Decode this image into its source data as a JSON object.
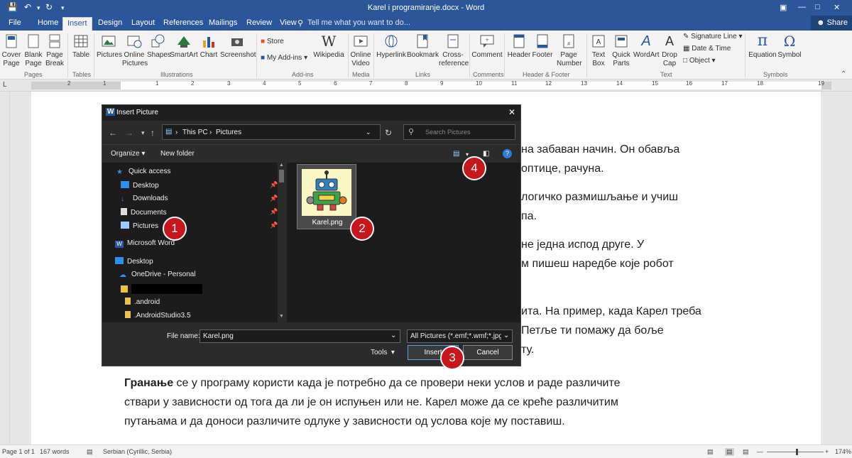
{
  "window": {
    "title": "Karel i programiranje.docx - Word"
  },
  "tabs": [
    "File",
    "Home",
    "Insert",
    "Design",
    "Layout",
    "References",
    "Mailings",
    "Review",
    "View"
  ],
  "active_tab": "Insert",
  "tell_me": "Tell me what you want to do...",
  "share": "Share",
  "ribbon": {
    "pages": {
      "group": "Pages",
      "cover": "Cover\nPage",
      "blank": "Blank\nPage",
      "break": "Page\nBreak"
    },
    "tables": {
      "group": "Tables",
      "table": "Table"
    },
    "illustrations": {
      "group": "Illustrations",
      "pictures": "Pictures",
      "online": "Online\nPictures",
      "shapes": "Shapes",
      "smartart": "SmartArt",
      "chart": "Chart",
      "screenshot": "Screenshot"
    },
    "addins": {
      "group": "Add-ins",
      "store": "Store",
      "myaddins": "My Add-ins",
      "wikipedia": "Wikipedia"
    },
    "media": {
      "group": "Media",
      "video": "Online\nVideo"
    },
    "links": {
      "group": "Links",
      "hyperlink": "Hyperlink",
      "bookmark": "Bookmark",
      "cross": "Cross-\nreference"
    },
    "comments": {
      "group": "Comments",
      "comment": "Comment"
    },
    "hf": {
      "group": "Header & Footer",
      "header": "Header",
      "footer": "Footer",
      "pagenum": "Page\nNumber"
    },
    "text": {
      "group": "Text",
      "textbox": "Text\nBox",
      "quickparts": "Quick\nParts",
      "wordart": "WordArt",
      "dropcap": "Drop\nCap",
      "sigline": "Signature Line",
      "datetime": "Date & Time",
      "object": "Object"
    },
    "symbols": {
      "group": "Symbols",
      "equation": "Equation",
      "symbol": "Symbol"
    }
  },
  "ruler_ticks": [
    "L",
    "2",
    "1",
    "1",
    "2",
    "3",
    "4",
    "5",
    "6",
    "7",
    "8",
    "9",
    "10",
    "11",
    "12",
    "13",
    "14",
    "15",
    "16",
    "17",
    "18",
    "19"
  ],
  "document": {
    "lines": [
      "на забаван начин. Он обавља",
      "оптице, рачуна.",
      "логичко размишљање и учиш",
      "па.",
      "не једна испод друге. У",
      "м пишеш наредбе које робот",
      "ита. На пример, када Карел треба",
      "Петље ти помажу да боље",
      "ту."
    ],
    "para_bold": "Гранање",
    "para_line1": " се у програму користи када је потребно да се провери неки услов и раде различите",
    "para_line2": "ствари у зависности од тога да ли је он испуњен или не. Карел може да се креће различитим",
    "para_line3": "путањама и да доноси различите одлуке у зависности од услова које му поставиш."
  },
  "status": {
    "page": "Page 1 of 1",
    "words": "167 words",
    "language": "Serbian (Cyrillic, Serbia)",
    "zoom": "174%"
  },
  "dialog": {
    "title": "Insert Picture",
    "path": [
      "This PC",
      "Pictures"
    ],
    "search_placeholder": "Search Pictures",
    "organize": "Organize",
    "new_folder": "New folder",
    "nav": {
      "quick_access": "Quick access",
      "desktop": "Desktop",
      "downloads": "Downloads",
      "documents": "Documents",
      "pictures": "Pictures",
      "word": "Microsoft Word",
      "desktop2": "Desktop",
      "onedrive": "OneDrive - Personal",
      "android": ".android",
      "studio": ".AndroidStudio3.5"
    },
    "file": {
      "name": "Karel.png"
    },
    "file_name_label": "File name:",
    "file_name_value": "Karel.png",
    "filter": "All Pictures (*.emf;*.wmf;*.jpg;*.j",
    "tools": "Tools",
    "insert": "Insert",
    "cancel": "Cancel"
  },
  "annotations": [
    "1",
    "2",
    "3",
    "4"
  ],
  "colors": {
    "word_blue": "#2b579a",
    "badge_red": "#c8161d",
    "dialog_bg": "#2b2b2b"
  }
}
